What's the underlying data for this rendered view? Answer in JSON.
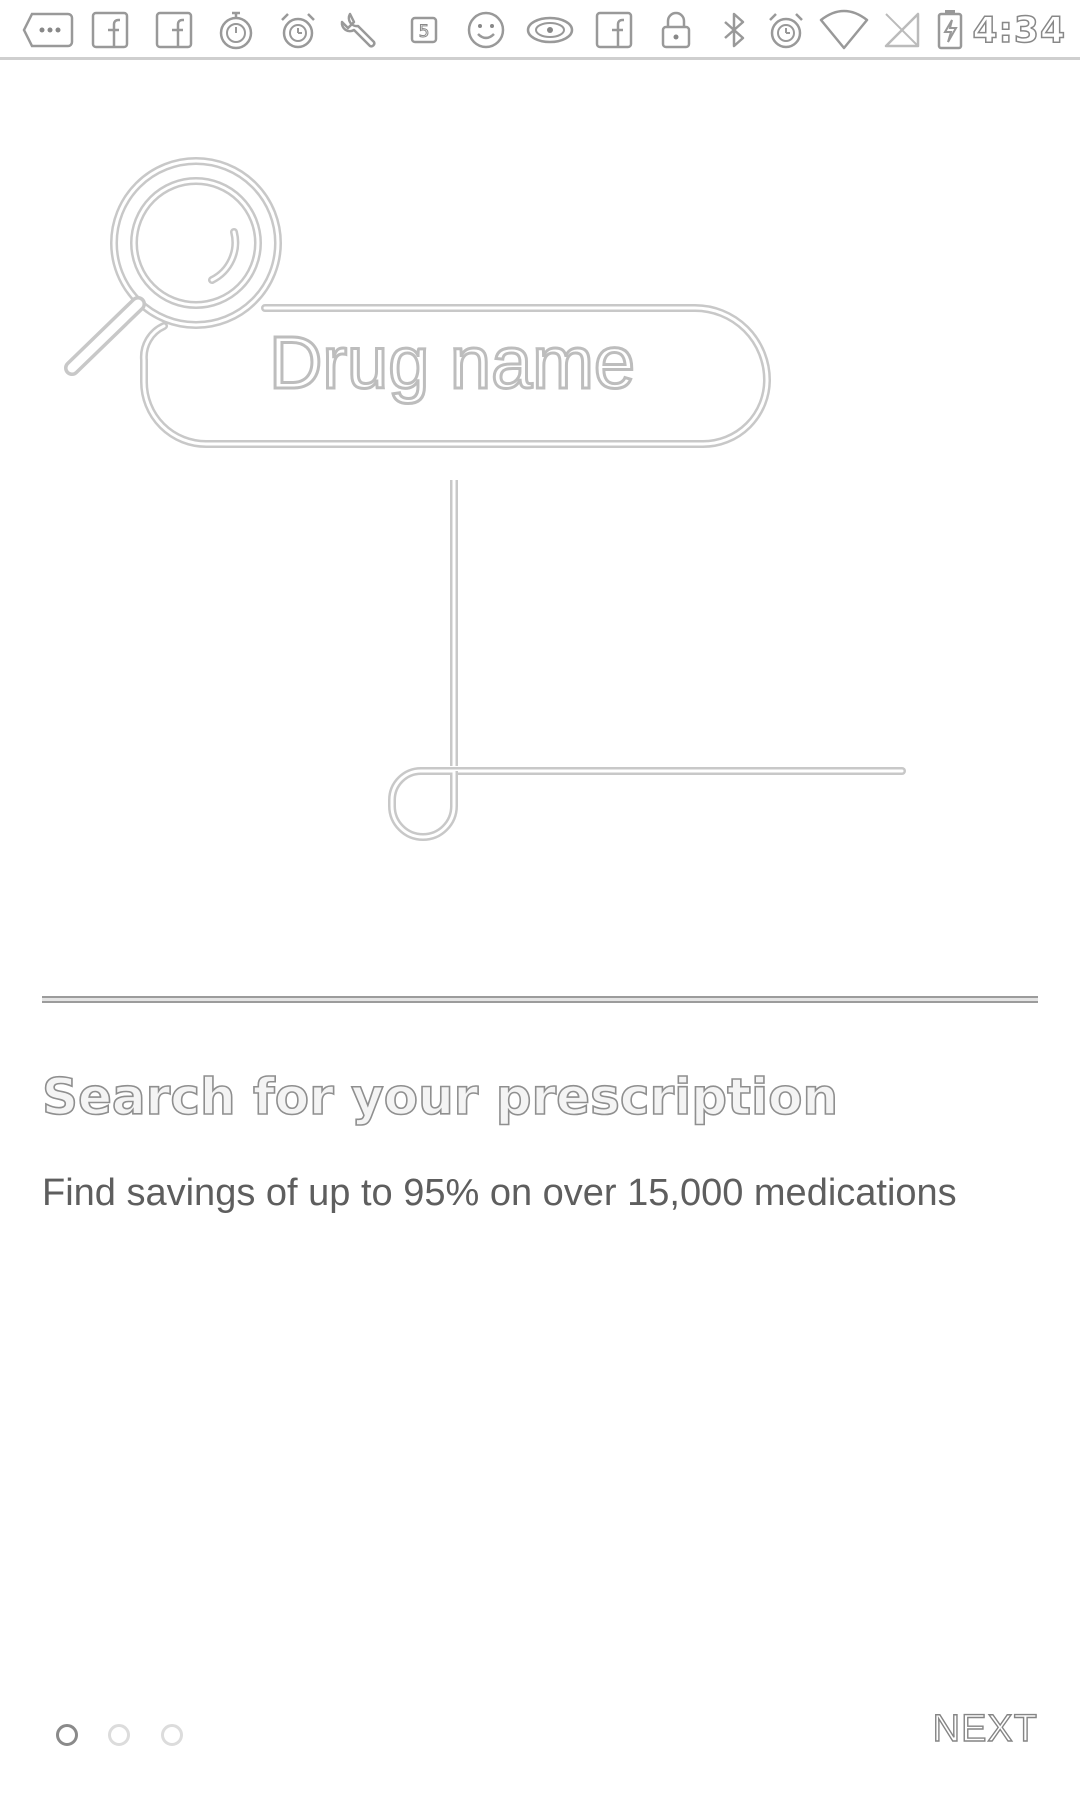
{
  "status_bar": {
    "time": "4:34",
    "icons": [
      "more-notifications-icon",
      "facebook-icon",
      "facebook-icon",
      "stopwatch-icon",
      "alarm-clock-icon",
      "wrench-icon",
      "five-badge-icon",
      "smiley-icon",
      "eye-icon",
      "facebook-icon",
      "lock-icon",
      "bluetooth-icon",
      "alarm-clock-icon",
      "wifi-icon",
      "no-sim-icon",
      "battery-charging-icon"
    ]
  },
  "illustration": {
    "field_text": "Drug name"
  },
  "content": {
    "title": "Search for your prescription",
    "subtitle": "Find savings of up to 95% on over 15,000 medications"
  },
  "pager": {
    "current_page": 1,
    "total_pages": 3
  },
  "footer": {
    "next_label": "NEXT"
  }
}
